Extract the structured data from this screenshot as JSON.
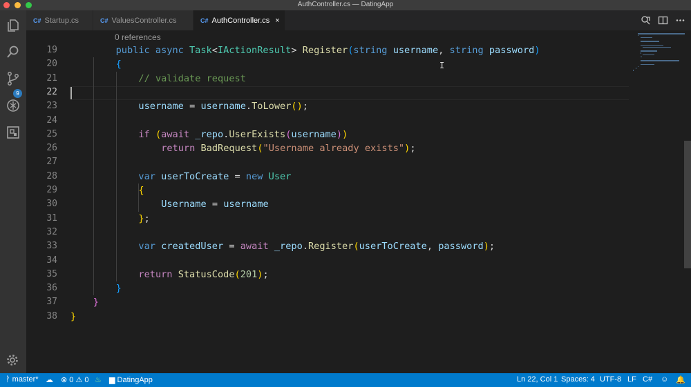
{
  "window": {
    "title": "AuthController.cs — DatingApp"
  },
  "activity": {
    "scm_badge": "9"
  },
  "tabs": [
    {
      "lang": "C#",
      "label": "Startup.cs"
    },
    {
      "lang": "C#",
      "label": "ValuesController.cs"
    },
    {
      "lang": "C#",
      "label": "AuthController.cs",
      "close": "×"
    }
  ],
  "editor": {
    "codelens": "0 references",
    "line_numbers": [
      "19",
      "20",
      "21",
      "22",
      "23",
      "24",
      "25",
      "26",
      "27",
      "28",
      "29",
      "30",
      "31",
      "32",
      "33",
      "34",
      "35",
      "36",
      "37",
      "38"
    ],
    "current_line": "22",
    "lines": [
      [
        [
          "kw",
          "public "
        ],
        [
          "kw",
          "async "
        ],
        [
          "ty",
          "Task"
        ],
        [
          "op",
          "<"
        ],
        [
          "ty",
          "IActionResult"
        ],
        [
          "op",
          "> "
        ],
        [
          "fn",
          "Register"
        ],
        [
          "p3",
          "("
        ],
        [
          "kw",
          "string "
        ],
        [
          "id",
          "username"
        ],
        [
          "op",
          ", "
        ],
        [
          "kw",
          "string "
        ],
        [
          "id",
          "password"
        ],
        [
          "p3",
          ")"
        ]
      ],
      [
        [
          "p3",
          "{"
        ]
      ],
      [
        [
          "cm",
          "// validate request"
        ]
      ],
      [],
      [
        [
          "id",
          "username "
        ],
        [
          "op",
          "= "
        ],
        [
          "id",
          "username"
        ],
        [
          "op",
          "."
        ],
        [
          "fn",
          "ToLower"
        ],
        [
          "p1",
          "()"
        ],
        [
          "op",
          ";"
        ]
      ],
      [],
      [
        [
          "ctl",
          "if "
        ],
        [
          "p1",
          "("
        ],
        [
          "ctl",
          "await "
        ],
        [
          "id",
          "_repo"
        ],
        [
          "op",
          "."
        ],
        [
          "fn",
          "UserExists"
        ],
        [
          "p2",
          "("
        ],
        [
          "id",
          "username"
        ],
        [
          "p2",
          ")"
        ],
        [
          "p1",
          ")"
        ]
      ],
      [
        [
          "ctl",
          "return "
        ],
        [
          "fn",
          "BadRequest"
        ],
        [
          "p1",
          "("
        ],
        [
          "st",
          "\"Username already exists\""
        ],
        [
          "p1",
          ")"
        ],
        [
          "op",
          ";"
        ]
      ],
      [],
      [
        [
          "kw",
          "var "
        ],
        [
          "id",
          "userToCreate "
        ],
        [
          "op",
          "= "
        ],
        [
          "kw",
          "new "
        ],
        [
          "ty",
          "User"
        ]
      ],
      [
        [
          "p1",
          "{"
        ]
      ],
      [
        [
          "id",
          "Username "
        ],
        [
          "op",
          "= "
        ],
        [
          "id",
          "username"
        ]
      ],
      [
        [
          "p1",
          "}"
        ],
        [
          "op",
          ";"
        ]
      ],
      [],
      [
        [
          "kw",
          "var "
        ],
        [
          "id",
          "createdUser "
        ],
        [
          "op",
          "= "
        ],
        [
          "ctl",
          "await "
        ],
        [
          "id",
          "_repo"
        ],
        [
          "op",
          "."
        ],
        [
          "fn",
          "Register"
        ],
        [
          "p1",
          "("
        ],
        [
          "id",
          "userToCreate"
        ],
        [
          "op",
          ", "
        ],
        [
          "id",
          "password"
        ],
        [
          "p1",
          ")"
        ],
        [
          "op",
          ";"
        ]
      ],
      [],
      [
        [
          "ctl",
          "return "
        ],
        [
          "fn",
          "StatusCode"
        ],
        [
          "p1",
          "("
        ],
        [
          "nu",
          "201"
        ],
        [
          "p1",
          ")"
        ],
        [
          "op",
          ";"
        ]
      ],
      [
        [
          "p3",
          "}"
        ]
      ],
      [
        [
          "p2",
          "}"
        ]
      ],
      [
        [
          "p1",
          "}"
        ]
      ]
    ],
    "indent": [
      8,
      8,
      12,
      0,
      12,
      0,
      12,
      16,
      0,
      12,
      12,
      16,
      12,
      0,
      12,
      0,
      12,
      8,
      4,
      0
    ]
  },
  "status": {
    "branch": "master*",
    "errors": "0",
    "warnings": "0",
    "project": "DatingApp",
    "position": "Ln 22, Col 1",
    "spaces": "Spaces: 4",
    "encoding": "UTF-8",
    "eol": "LF",
    "language": "C#"
  },
  "colors": {
    "statusbar": "#007acc",
    "activitybar": "#333333",
    "editor_bg": "#1e1e1e"
  }
}
